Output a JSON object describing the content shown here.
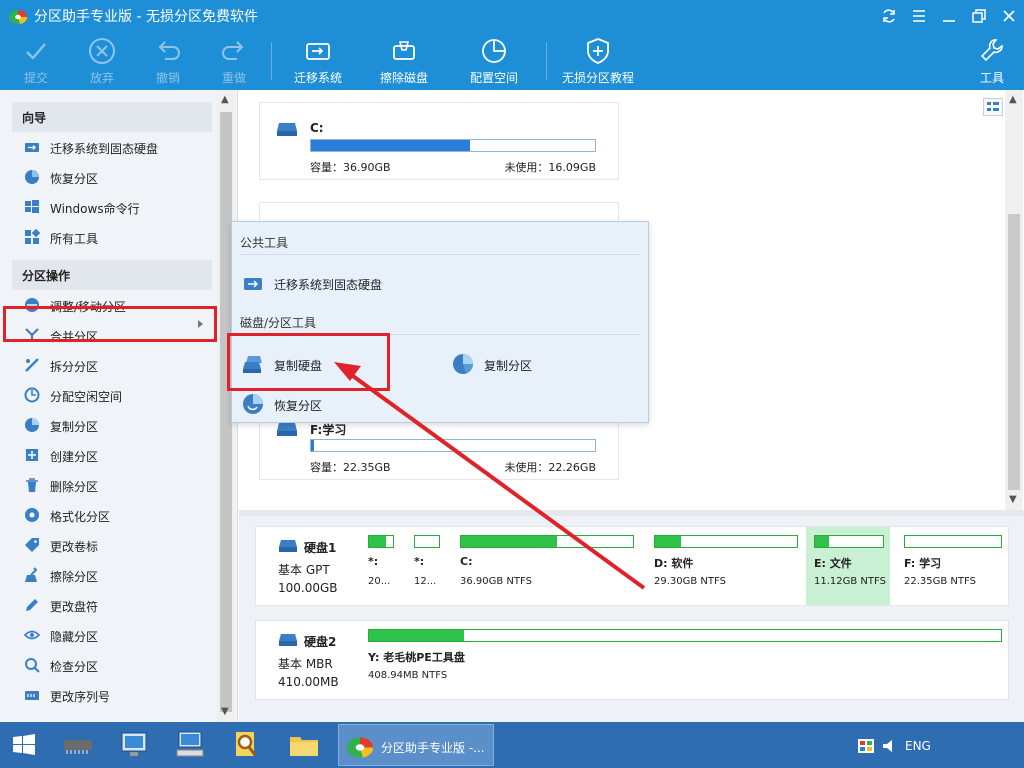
{
  "window": {
    "title": "分区助手专业版 - 无损分区免费软件"
  },
  "toolbar": {
    "submit": "提交",
    "discard": "放弃",
    "undo": "撤销",
    "redo": "重做",
    "migrate": "迁移系统",
    "wipe": "擦除磁盘",
    "config": "配置空间",
    "tutorial": "无损分区教程",
    "tools": "工具"
  },
  "sidebar": {
    "wizard_title": "向导",
    "wizard_items": [
      {
        "label": "迁移系统到固态硬盘",
        "icon": "migrate-ssd-icon"
      },
      {
        "label": "恢复分区",
        "icon": "recover-partition-icon"
      },
      {
        "label": "Windows命令行",
        "icon": "windows-icon"
      },
      {
        "label": "所有工具",
        "icon": "all-tools-icon"
      }
    ],
    "ops_title": "分区操作",
    "ops_items": [
      {
        "label": "调整/移动分区",
        "icon": "resize-icon"
      },
      {
        "label": "合并分区",
        "icon": "merge-icon"
      },
      {
        "label": "拆分分区",
        "icon": "split-icon"
      },
      {
        "label": "分配空闲空间",
        "icon": "allocate-icon"
      },
      {
        "label": "复制分区",
        "icon": "copy-partition-icon"
      },
      {
        "label": "创建分区",
        "icon": "create-partition-icon"
      },
      {
        "label": "删除分区",
        "icon": "delete-icon"
      },
      {
        "label": "格式化分区",
        "icon": "format-icon"
      },
      {
        "label": "更改卷标",
        "icon": "label-icon"
      },
      {
        "label": "擦除分区",
        "icon": "wipe-icon"
      },
      {
        "label": "更改盘符",
        "icon": "drive-letter-icon"
      },
      {
        "label": "隐藏分区",
        "icon": "hide-icon"
      },
      {
        "label": "检查分区",
        "icon": "check-icon"
      },
      {
        "label": "更改序列号",
        "icon": "serial-icon"
      }
    ]
  },
  "partitions_view": {
    "cards": [
      {
        "name": "C:",
        "used_fraction": 0.56,
        "capacity": "容量：36.90GB",
        "free": "未使用：16.09GB"
      },
      {
        "name": "F:学习",
        "used_fraction": 0.01,
        "capacity": "容量：22.35GB",
        "free": "未使用：22.26GB"
      }
    ]
  },
  "flyout": {
    "section_public": "公共工具",
    "migrate": "迁移系统到固态硬盘",
    "section_disk": "磁盘/分区工具",
    "copy_disk": "复制硬盘",
    "copy_partition": "复制分区",
    "recover": "恢复分区"
  },
  "disks": [
    {
      "title": "硬盘1",
      "type": "基本 GPT",
      "size": "100.00GB",
      "partitions": [
        {
          "label": "*:",
          "size": "20...",
          "used": 0.7,
          "selected": false
        },
        {
          "label": "*:",
          "size": "12...",
          "used": 0.0,
          "selected": false
        },
        {
          "label": "C:",
          "size": "36.90GB NTFS",
          "used": 0.56,
          "selected": false
        },
        {
          "label": "D: 软件",
          "size": "29.30GB NTFS",
          "used": 0.18,
          "selected": false
        },
        {
          "label": "E: 文件",
          "size": "11.12GB NTFS",
          "used": 0.2,
          "selected": true
        },
        {
          "label": "F: 学习",
          "size": "22.35GB NTFS",
          "used": 0.0,
          "selected": false
        }
      ]
    },
    {
      "title": "硬盘2",
      "type": "基本 MBR",
      "size": "410.00MB",
      "partitions": [
        {
          "label": "Y: 老毛桃PE工具盘",
          "size": "408.94MB NTFS",
          "used": 0.15,
          "selected": false
        }
      ]
    }
  ],
  "taskbar": {
    "active_label": "分区助手专业版 -...",
    "lang": "ENG"
  },
  "colors": {
    "accent": "#1e8fd6",
    "highlight": "#e0222a",
    "partition_fill": "#2fc24a",
    "bar_fill": "#2b7ed8"
  }
}
